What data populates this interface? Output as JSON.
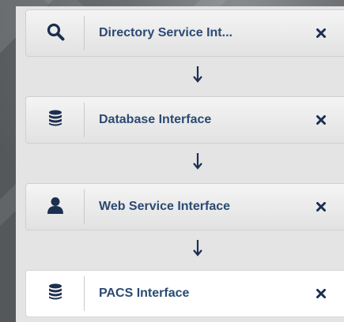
{
  "nodes": [
    {
      "label": "Directory Service Int...",
      "icon": "search-icon"
    },
    {
      "label": "Database Interface",
      "icon": "database-icon"
    },
    {
      "label": "Web Service Interface",
      "icon": "user-icon"
    },
    {
      "label": "PACS Interface",
      "icon": "database-icon"
    }
  ],
  "colors": {
    "label": "#2b4a73",
    "icon": "#1b2f4f",
    "close": "#1b2f4f",
    "arrow": "#1b2f4f",
    "active_card": "#ffffff"
  },
  "connector": "arrow-down-icon",
  "close_icon": "close-icon",
  "active_node": 3
}
